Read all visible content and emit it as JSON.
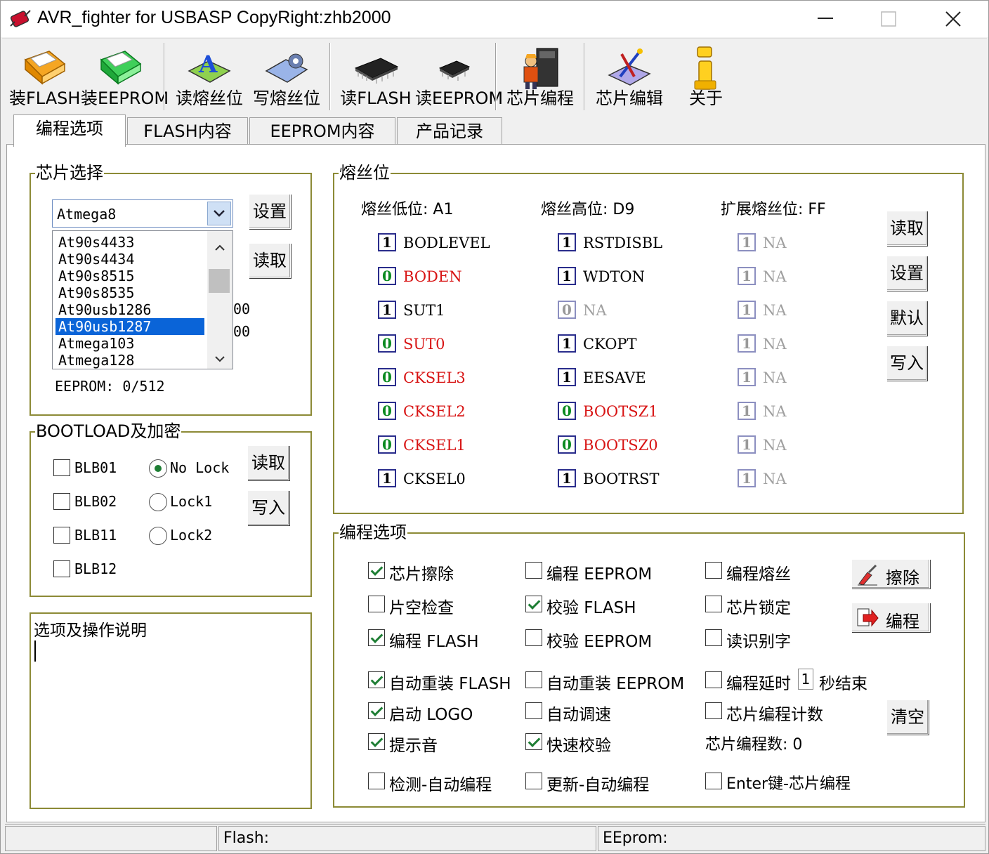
{
  "window": {
    "title": "AVR_fighter for USBASP CopyRight:zhb2000"
  },
  "toolbar": {
    "load_flash": "装FLASH",
    "load_eeprom": "装EEPROM",
    "read_fuse": "读熔丝位",
    "write_fuse": "写熔丝位",
    "read_flash": "读FLASH",
    "read_eeprom": "读EEPROM",
    "program_chip": "芯片编程",
    "edit_chip": "芯片编辑",
    "about": "关于"
  },
  "tabs": [
    "编程选项",
    "FLASH内容",
    "EEPROM内容",
    "产品记录"
  ],
  "chip_select": {
    "title": "芯片选择",
    "selected": "Atmega8",
    "set_button": "设置",
    "read_button": "读取",
    "list": [
      "At90s4433",
      "At90s4434",
      "At90s8515",
      "At90s8535",
      "At90usb1286",
      "At90usb1287",
      "Atmega103",
      "Atmega128"
    ],
    "hidden_1": "00",
    "hidden_2": "00",
    "eeprom_info": "EEPROM: 0/512"
  },
  "bootload": {
    "title": "BOOTLOAD及加密",
    "blb01": "BLB01",
    "blb02": "BLB02",
    "blb11": "BLB11",
    "blb12": "BLB12",
    "nolock": "No Lock",
    "lock1": "Lock1",
    "lock2": "Lock2",
    "read_button": "读取",
    "write_button": "写入"
  },
  "notes": {
    "title": "选项及操作说明"
  },
  "fuse": {
    "title": "熔丝位",
    "low_label": "熔丝低位: A1",
    "high_label": "熔丝高位: D9",
    "ext_label": "扩展熔丝位: FF",
    "low": [
      {
        "v": "1",
        "n": "BODLEVEL"
      },
      {
        "v": "0",
        "n": "BODEN"
      },
      {
        "v": "1",
        "n": "SUT1"
      },
      {
        "v": "0",
        "n": "SUT0"
      },
      {
        "v": "0",
        "n": "CKSEL3"
      },
      {
        "v": "0",
        "n": "CKSEL2"
      },
      {
        "v": "0",
        "n": "CKSEL1"
      },
      {
        "v": "1",
        "n": "CKSEL0"
      }
    ],
    "high": [
      {
        "v": "1",
        "n": "RSTDISBL"
      },
      {
        "v": "1",
        "n": "WDTON"
      },
      {
        "v": "0",
        "n": "NA"
      },
      {
        "v": "1",
        "n": "CKOPT"
      },
      {
        "v": "1",
        "n": "EESAVE"
      },
      {
        "v": "0",
        "n": "BOOTSZ1"
      },
      {
        "v": "0",
        "n": "BOOTSZ0"
      },
      {
        "v": "1",
        "n": "BOOTRST"
      }
    ],
    "ext": [
      {
        "v": "1",
        "n": "NA"
      },
      {
        "v": "1",
        "n": "NA"
      },
      {
        "v": "1",
        "n": "NA"
      },
      {
        "v": "1",
        "n": "NA"
      },
      {
        "v": "1",
        "n": "NA"
      },
      {
        "v": "1",
        "n": "NA"
      },
      {
        "v": "1",
        "n": "NA"
      },
      {
        "v": "1",
        "n": "NA"
      }
    ],
    "read_button": "读取",
    "set_button": "设置",
    "default_button": "默认",
    "write_button": "写入"
  },
  "prog": {
    "title": "编程选项",
    "chip_erase": "芯片擦除",
    "blank_check": "片空检查",
    "prog_flash": "编程 FLASH",
    "prog_eeprom": "编程 EEPROM",
    "verify_flash": "校验 FLASH",
    "verify_eeprom": "校验 EEPROM",
    "prog_fuse": "编程熔丝",
    "chip_lock": "芯片锁定",
    "read_sig": "读识别字",
    "erase_button": "擦除",
    "program_button": "编程",
    "auto_reload_flash": "自动重装 FLASH",
    "auto_reload_eeprom": "自动重装 EEPROM",
    "prog_delay": "编程延时",
    "delay_value": "1",
    "delay_suffix": "秒结束",
    "boot_logo": "启动 LOGO",
    "auto_speed": "自动调速",
    "chip_count": "芯片编程计数",
    "beep": "提示音",
    "fast_verify": "快速校验",
    "count_label": "芯片编程数: 0",
    "clear_button": "清空",
    "detect_auto": "检测-自动编程",
    "update_auto": "更新-自动编程",
    "enter_key": "Enter键-芯片编程"
  },
  "status": {
    "flash": "Flash:",
    "eeprom": "EEprom:"
  }
}
